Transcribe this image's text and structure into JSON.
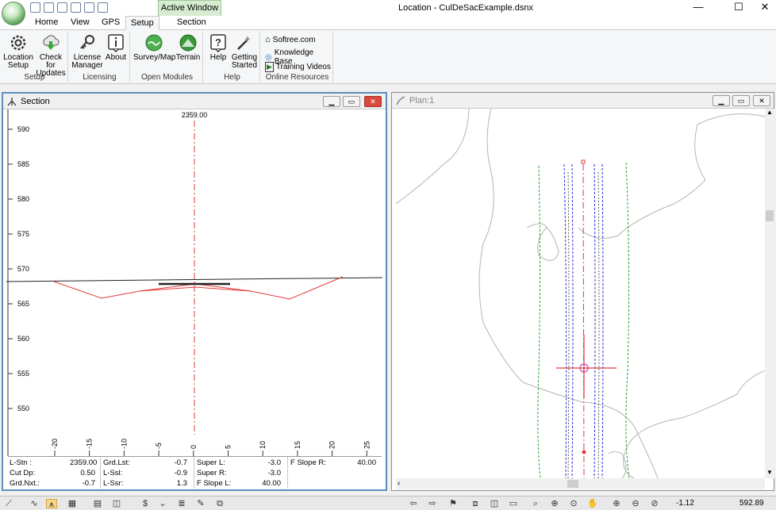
{
  "window": {
    "title": "Location - CulDeSacExample.dsnx",
    "active_window_tab": "Active Window",
    "minimize": "—",
    "maximize": "☐",
    "close": "✕"
  },
  "tabs": [
    {
      "label": "Home"
    },
    {
      "label": "View"
    },
    {
      "label": "GPS"
    },
    {
      "label": "Setup"
    },
    {
      "label": "Section"
    }
  ],
  "ribbon": {
    "groups": {
      "setup": "Setup",
      "licensing": "Licensing",
      "open_modules": "Open Modules",
      "help": "Help",
      "online_resources": "Online Resources"
    },
    "buttons": {
      "location_setup": [
        "Location",
        "Setup"
      ],
      "check_updates": [
        "Check for",
        "Updates"
      ],
      "license_manager": [
        "License",
        "Manager"
      ],
      "about": "About",
      "survey_map": "Survey/Map",
      "terrain": "Terrain",
      "help": "Help",
      "getting_started": [
        "Getting",
        "Started"
      ]
    },
    "links": {
      "softree": "Softree.com",
      "knowledge_base": "Knowledge Base",
      "training_videos": "Training Videos"
    }
  },
  "section_panel": {
    "title": "Section",
    "station_label": "2359.00",
    "y_ticks": [
      "590",
      "585",
      "580",
      "575",
      "570",
      "565",
      "560",
      "555",
      "550"
    ],
    "x_ticks": [
      "-20",
      "-15",
      "-10",
      "-5",
      "0",
      "5",
      "10",
      "15",
      "20",
      "25"
    ],
    "info": {
      "l_stn_label": "L-Stn :",
      "l_stn_value": "2359.00",
      "cut_dp_label": "Cut Dp:",
      "cut_dp_value": "0.50",
      "grd_nxt_label": "Grd.Nxt.:",
      "grd_nxt_value": "-0.7",
      "grd_lst_label": "Grd.Lst:",
      "grd_lst_value": "-0.7",
      "l_ssl_label": "L-Ssl:",
      "l_ssl_value": "-0.9",
      "l_ssr_label": "L-Ssr:",
      "l_ssr_value": "1.3",
      "super_l_label": "Super L:",
      "super_l_value": "-3.0",
      "super_r_label": "Super R:",
      "super_r_value": "-3.0",
      "f_slope_l_label": "F Slope L:",
      "f_slope_l_value": "40.00",
      "f_slope_r_label": "F Slope R:",
      "f_slope_r_value": "40.00"
    }
  },
  "plan_panel": {
    "title": "Plan:1"
  },
  "statusbar": {
    "value_a": "-1.12",
    "value_b": "592.89"
  },
  "colors": {
    "design_red": "#e23a3a",
    "ground_line": "#222222",
    "plan_green": "#2aa02a",
    "plan_blue": "#2b2bd6",
    "contour_gray": "#b4b4b4",
    "active_tab_green": "#d6ecd1"
  }
}
